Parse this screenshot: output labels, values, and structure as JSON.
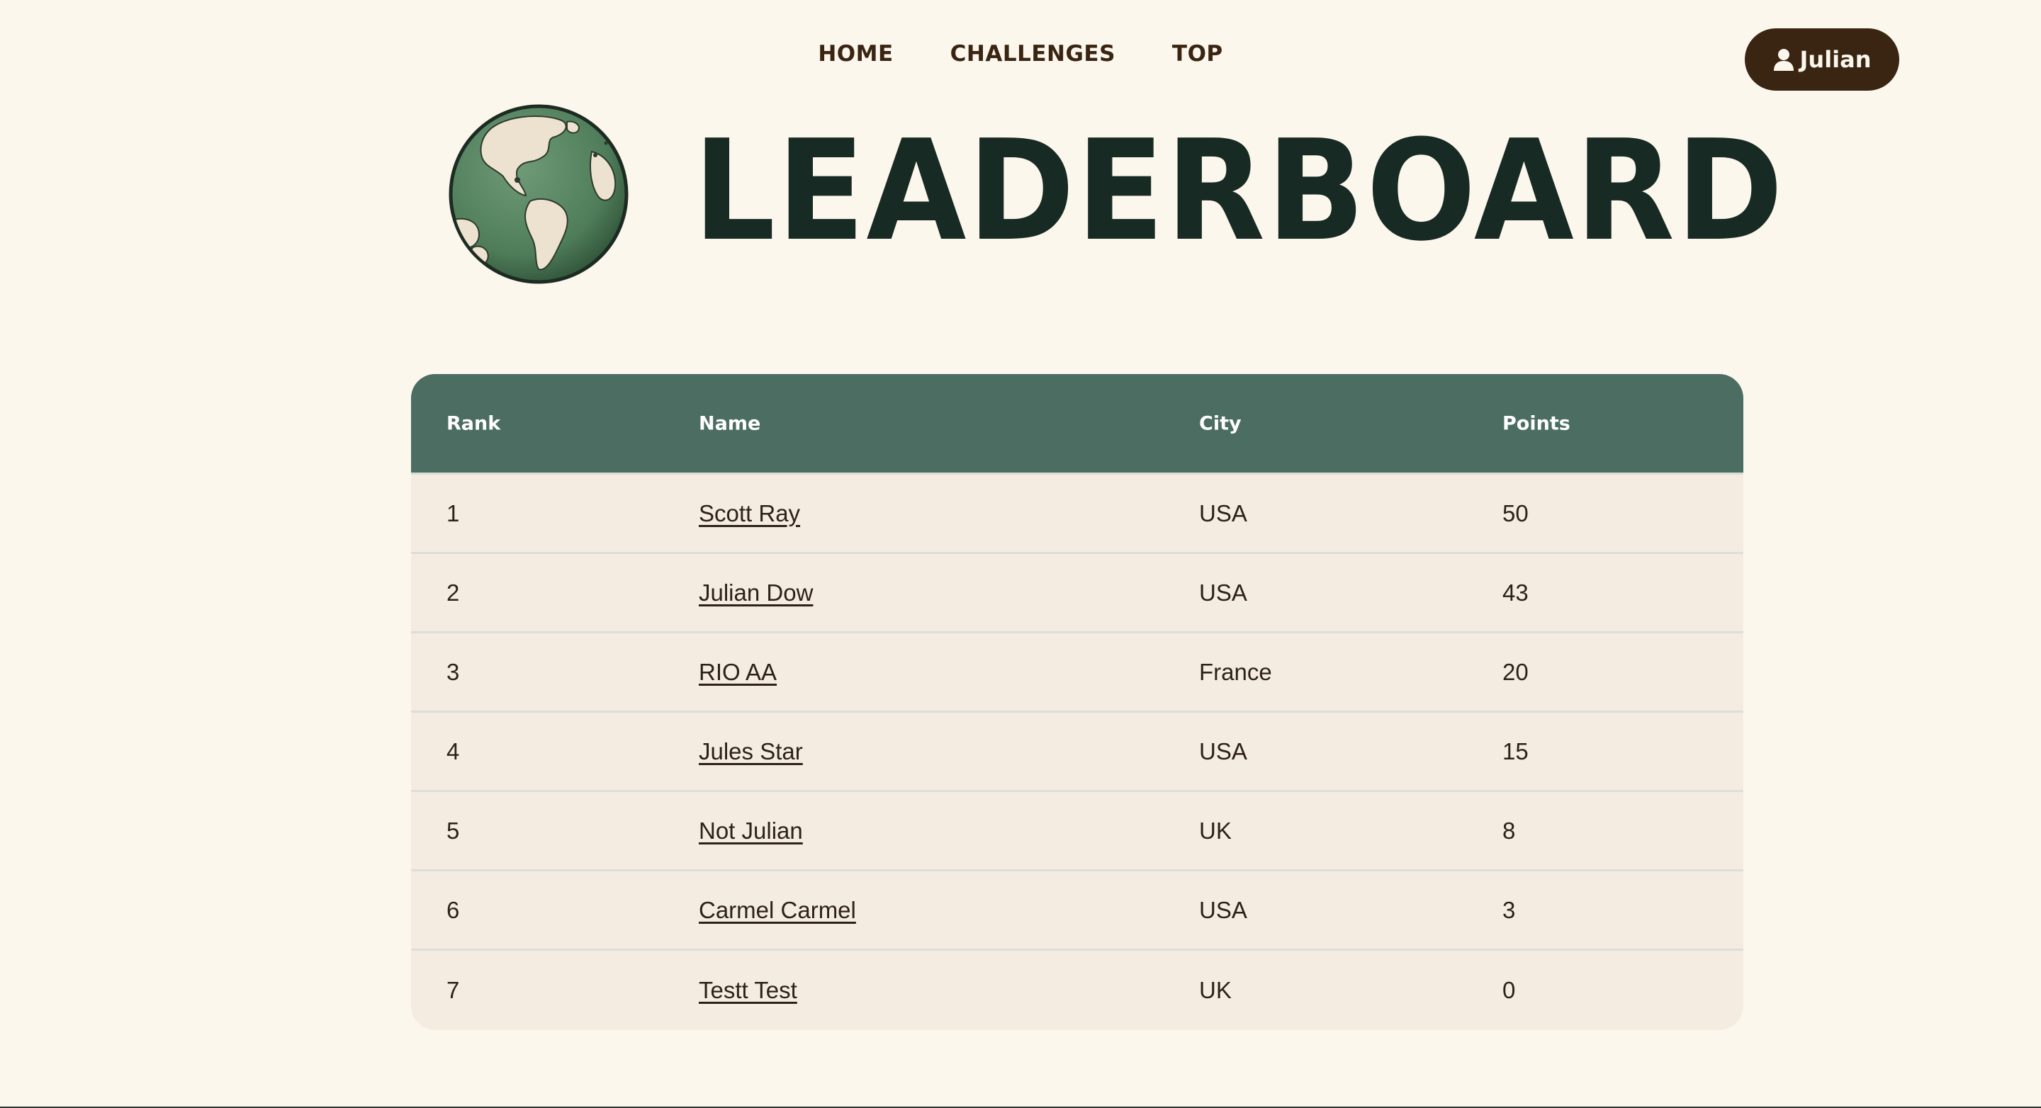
{
  "nav": {
    "items": [
      {
        "label": "HOME"
      },
      {
        "label": "CHALLENGES"
      },
      {
        "label": "TOP"
      }
    ],
    "user": {
      "name": "Julian",
      "icon": "user-icon"
    }
  },
  "hero": {
    "title": "LEADERBOARD",
    "logo": "globe-icon"
  },
  "table": {
    "headers": {
      "rank": "Rank",
      "name": "Name",
      "city": "City",
      "points": "Points"
    },
    "rows": [
      {
        "rank": "1",
        "name": "Scott Ray",
        "city": "USA",
        "points": "50"
      },
      {
        "rank": "2",
        "name": "Julian Dow",
        "city": "USA",
        "points": "43"
      },
      {
        "rank": "3",
        "name": "RIO AA",
        "city": "France",
        "points": "20"
      },
      {
        "rank": "4",
        "name": "Jules Star",
        "city": "USA",
        "points": "15"
      },
      {
        "rank": "5",
        "name": "Not Julian",
        "city": "UK",
        "points": "8"
      },
      {
        "rank": "6",
        "name": "Carmel Carmel",
        "city": "USA",
        "points": "3"
      },
      {
        "rank": "7",
        "name": "Testt Test",
        "city": "UK",
        "points": "0"
      }
    ]
  },
  "colors": {
    "background": "#fcf7ed",
    "header_green": "#4c6d61",
    "row_bg": "#f4ece1",
    "dark_brown": "#3a2412",
    "title_color": "#182a24"
  }
}
